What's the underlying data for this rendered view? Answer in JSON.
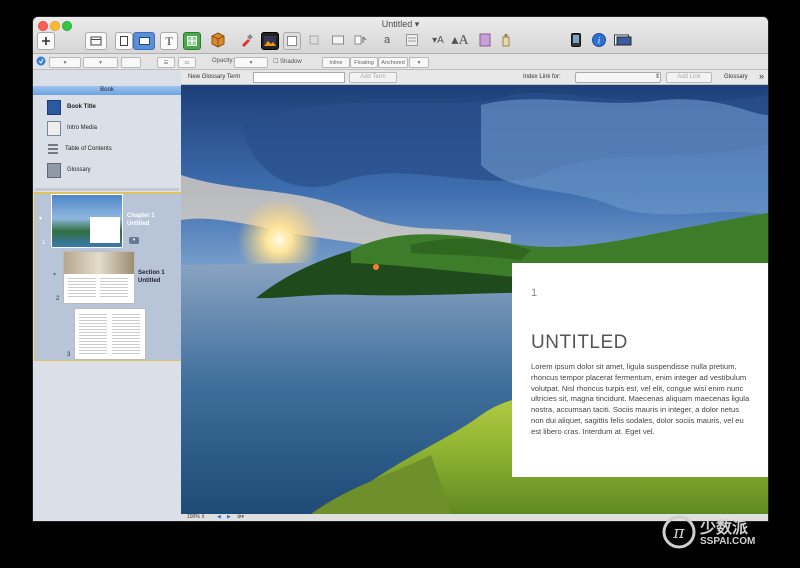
{
  "window": {
    "title": "Untitled"
  },
  "toolbar": {
    "add_icon": "plus-icon",
    "text_label": "T",
    "info_label": "i"
  },
  "format_bar": {
    "opacity_label": "Opacity:",
    "shadow_label": "Shadow",
    "wrap": [
      "Inline",
      "Floating",
      "Anchored"
    ]
  },
  "glossary_bar": {
    "new_term_label": "New Glossary Term",
    "add_term_button": "Add Term",
    "index_link_label": "Index Link for:",
    "add_link_button": "Add Link",
    "glossary_button": "Glossary"
  },
  "sidebar": {
    "header": "Book",
    "items": [
      {
        "label": "Book Title",
        "icon": "book-icon"
      },
      {
        "label": "Intro Media",
        "icon": "film-icon"
      },
      {
        "label": "Table of Contents",
        "icon": "list-icon"
      },
      {
        "label": "Glossary",
        "icon": "glossary-icon"
      }
    ],
    "pages": [
      {
        "number": "1",
        "title": "Chapter 1",
        "subtitle": "Untitled"
      },
      {
        "number": "2",
        "title": "Section 1",
        "subtitle": "Untitled"
      },
      {
        "number": "3"
      }
    ]
  },
  "document": {
    "page_number": "1",
    "heading": "UNTITLED",
    "body": "Lorem ipsum dolor sit amet, ligula suspendisse nulla pretium, rhoncus tempor placerat fermentum, enim integer ad vestibulum volutpat. Nisl rhoncus turpis est, vel elit, congue wisi enim nunc ultricies sit, magna tincidunt. Maecenas aliquam maecenas ligula nostra, accumsan taciti. Sociis mauris in integer, a dolor netus non dui aliquet, sagittis felis sodales, dolor sociis mauris, vel eu est libero cras. Interdum at. Eget vel."
  },
  "status_bar": {
    "zoom": "100%"
  },
  "watermark": {
    "glyph": "π",
    "cn": "少数派",
    "text": "SSPAI.COM"
  }
}
